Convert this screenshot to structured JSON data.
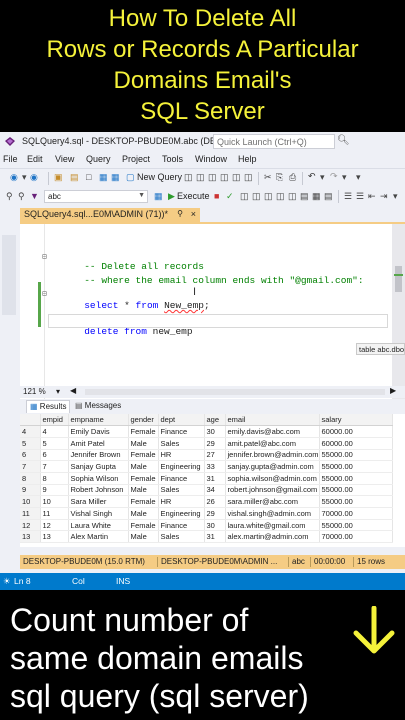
{
  "banner_top": {
    "lines": [
      "How To Delete All",
      "Rows or Records A Particular",
      "Domains Email's",
      "SQL Server"
    ],
    "color": "#f5f23a"
  },
  "titlebar": {
    "title": "SQLQuery4.sql - DESKTOP-PBUDE0M.abc (DE...",
    "quick_launch_placeholder": "Quick Launch (Ctrl+Q)"
  },
  "menu": [
    "File",
    "Edit",
    "View",
    "Query",
    "Project",
    "Tools",
    "Window",
    "Help"
  ],
  "toolbar": {
    "new_query_label": "New Query",
    "database_selected": "abc",
    "execute_label": "Execute"
  },
  "document_tab": {
    "label": "SQLQuery4.sql...E0M\\ADMIN (71))*",
    "accent": "#f5cc84"
  },
  "editor": {
    "comment1": "-- Delete all records",
    "comment2_prefix": "-- where the email column ends with ",
    "comment2_string": "\"@gmail.com\"",
    "comment2_suffix": ":",
    "select_kw": "select",
    "select_rest": " * ",
    "from_kw": "from",
    "select_table": "New_emp",
    "select_end": ";",
    "delete_kw": "delete",
    "delete_from_kw": "from",
    "delete_table": "new_emp",
    "tooltip": "table abc.dbo"
  },
  "zoom": "121 %",
  "results_tabs": {
    "results": "Results",
    "messages": "Messages"
  },
  "grid": {
    "columns": [
      "empid",
      "empname",
      "gender",
      "dept",
      "age",
      "email",
      "salary"
    ],
    "rows": [
      {
        "row": "4",
        "empid": "4",
        "empname": "Emily Davis",
        "gender": "Female",
        "dept": "Finance",
        "age": "30",
        "email": "emily.davis@abc.com",
        "salary": "60000.00"
      },
      {
        "row": "5",
        "empid": "5",
        "empname": "Amit Patel",
        "gender": "Male",
        "dept": "Sales",
        "age": "29",
        "email": "amit.patel@abc.com",
        "salary": "60000.00"
      },
      {
        "row": "6",
        "empid": "6",
        "empname": "Jennifer Brown",
        "gender": "Female",
        "dept": "HR",
        "age": "27",
        "email": "jennifer.brown@admin.com",
        "salary": "55000.00"
      },
      {
        "row": "7",
        "empid": "7",
        "empname": "Sanjay Gupta",
        "gender": "Male",
        "dept": "Engineering",
        "age": "33",
        "email": "sanjay.gupta@admin.com",
        "salary": "55000.00"
      },
      {
        "row": "8",
        "empid": "8",
        "empname": "Sophia Wilson",
        "gender": "Female",
        "dept": "Finance",
        "age": "31",
        "email": "sophia.wilson@admin.com",
        "salary": "55000.00"
      },
      {
        "row": "9",
        "empid": "9",
        "empname": "Robert Johnson",
        "gender": "Male",
        "dept": "Sales",
        "age": "34",
        "email": "robert.johnson@gmail.com",
        "salary": "55000.00"
      },
      {
        "row": "10",
        "empid": "10",
        "empname": "Sara Miller",
        "gender": "Female",
        "dept": "HR",
        "age": "26",
        "email": "sara.miller@abc.com",
        "salary": "55000.00"
      },
      {
        "row": "11",
        "empid": "11",
        "empname": "Vishal Singh",
        "gender": "Male",
        "dept": "Engineering",
        "age": "29",
        "email": "vishal.singh@admin.com",
        "salary": "70000.00"
      },
      {
        "row": "12",
        "empid": "12",
        "empname": "Laura White",
        "gender": "Female",
        "dept": "Finance",
        "age": "30",
        "email": "laura.white@gmail.com",
        "salary": "55000.00"
      },
      {
        "row": "13",
        "empid": "13",
        "empname": "Alex Martin",
        "gender": "Male",
        "dept": "Sales",
        "age": "31",
        "email": "alex.martin@admin.com",
        "salary": "70000.00"
      }
    ]
  },
  "status": {
    "server": "DESKTOP-PBUDE0M (15.0 RTM)",
    "user": "DESKTOP-PBUDE0M\\ADMIN ...",
    "database": "abc",
    "time": "00:00:00",
    "rows": "15 rows",
    "accent": "#f5cc84"
  },
  "editor_status": {
    "line": "Ln 8",
    "col": "Col",
    "ins": "INS",
    "accent": "#007acc"
  },
  "banner_bottom": {
    "lines": [
      "Count number of",
      "same domain emails",
      "sql query (sql server)"
    ],
    "arrow_icon": "down-arrow-icon",
    "arrow_color": "#f5f23a"
  }
}
